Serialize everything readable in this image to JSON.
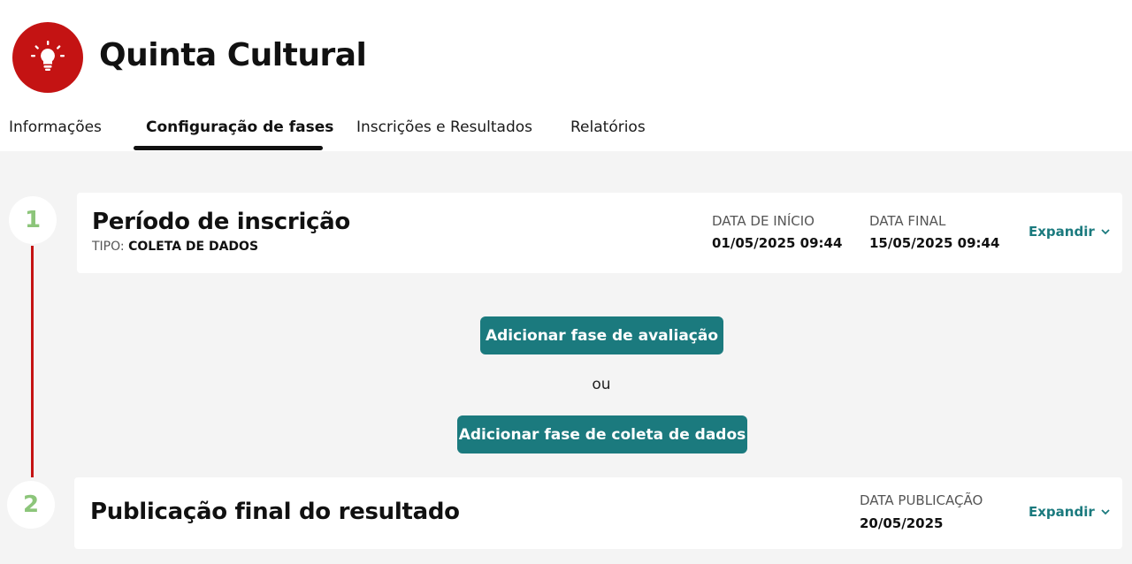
{
  "header": {
    "title": "Quinta Cultural",
    "logo_icon": "lightbulb-icon",
    "brand_color": "#c41313"
  },
  "tabs": [
    {
      "label": "Informações",
      "active": false
    },
    {
      "label": "Configuração de fases",
      "active": true
    },
    {
      "label": "Inscrições e Resultados",
      "active": false
    },
    {
      "label": "Relatórios",
      "active": false
    }
  ],
  "phases": [
    {
      "number": "1",
      "title": "Período de inscrição",
      "type_label": "TIPO:",
      "type_value": "COLETA DE DADOS",
      "start_label": "DATA DE INÍCIO",
      "start_value": "01/05/2025 09:44",
      "end_label": "DATA FINAL",
      "end_value": "15/05/2025 09:44",
      "expand_label": "Expandir"
    },
    {
      "number": "2",
      "title": "Publicação final do resultado",
      "pub_label": "DATA PUBLICAÇÃO",
      "pub_value": "20/05/2025",
      "expand_label": "Expandir"
    }
  ],
  "actions": {
    "add_evaluation": "Adicionar fase de avaliação",
    "or_text": "ou",
    "add_data_collection": "Adicionar fase de coleta de dados"
  },
  "colors": {
    "accent": "#1b7a7e",
    "timeline": "#c41313",
    "step_number": "#8cc57a",
    "background": "#f4f4f4"
  }
}
